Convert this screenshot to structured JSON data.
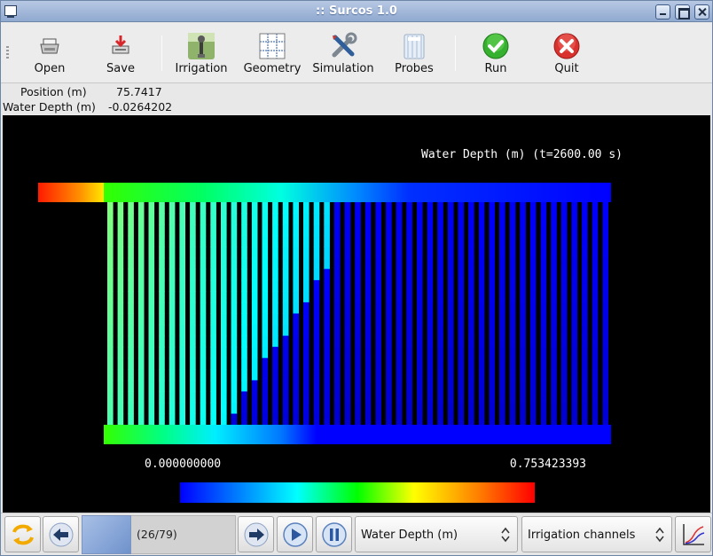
{
  "window": {
    "title": ":: Surcos 1.0"
  },
  "toolbar": {
    "open": "Open",
    "save": "Save",
    "irrigation": "Irrigation",
    "geometry": "Geometry",
    "simulation": "Simulation",
    "probes": "Probes",
    "run": "Run",
    "quit": "Quit"
  },
  "info": {
    "position_label": "Position (m)",
    "position_value": "75.7417",
    "depth_label": "Water Depth (m)",
    "depth_value": "-0.0264202"
  },
  "plot": {
    "title": "Water Depth (m) (t=2600.00 s)",
    "colorbar_min": "0.000000000",
    "colorbar_max": "0.753423393",
    "colors": {
      "background": "#000000",
      "low": "#0000ff",
      "high": "#ff0000"
    }
  },
  "bottombar": {
    "frame_label": "(26/79)",
    "variable_select": "Water Depth (m)",
    "view_select": "Irrigation channels"
  },
  "icons": {
    "refresh": "refresh-icon",
    "back": "arrow-left-icon",
    "forward": "arrow-right-icon",
    "play": "play-icon",
    "pause": "pause-icon",
    "chart": "chart-icon"
  }
}
